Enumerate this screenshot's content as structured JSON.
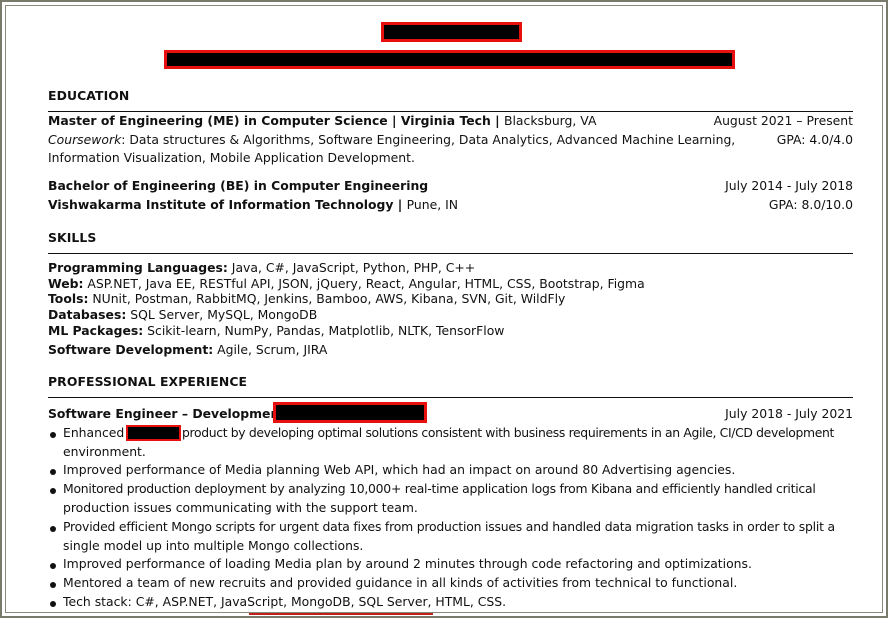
{
  "header": {
    "name_redacted": true,
    "contact_redacted": true
  },
  "education": {
    "title": "EDUCATION",
    "entries": [
      {
        "degree": "Master of Engineering (ME) in Computer Science",
        "sep": " | ",
        "school": "Virginia Tech",
        "sep2": " | ",
        "location": "Blacksburg, VA",
        "dates": "August 2021 – Present",
        "coursework_label": "Coursework",
        "coursework_line1": ": Data structures & Algorithms, Software Engineering, Data Analytics, Advanced Machine Learning,",
        "coursework_line2": "Information Visualization, Mobile Application Development.",
        "gpa": "GPA: 4.0/4.0"
      },
      {
        "degree": "Bachelor of Engineering (BE) in Computer Engineering",
        "dates": "July 2014 - July 2018",
        "school": "Vishwakarma Institute of Information Technology",
        "sep": " | ",
        "location": "Pune, IN",
        "gpa": "GPA: 8.0/10.0"
      }
    ]
  },
  "skills": {
    "title": "SKILLS",
    "items": [
      {
        "label": "Programming Languages:",
        "value": " Java, C#, JavaScript, Python, PHP, C++"
      },
      {
        "label": "Web:",
        "value": " ASP.NET, Java EE, RESTful API, JSON, jQuery, React, Angular, HTML, CSS, Bootstrap, Figma"
      },
      {
        "label": "Tools:",
        "value": " NUnit, Postman, RabbitMQ, Jenkins, Bamboo, AWS, Kibana, SVN, Git, WildFly"
      },
      {
        "label": "Databases:",
        "value": " SQL Server, MySQL,  MongoDB"
      },
      {
        "label": "ML Packages:",
        "value": " Scikit-learn, NumPy, Pandas, Matplotlib, NLTK, TensorFlow"
      },
      {
        "label": "Software Development:",
        "value": " Agile, Scrum, JIRA"
      }
    ]
  },
  "experience": {
    "title": "PROFESSIONAL EXPERIENCE",
    "jobs": [
      {
        "role": "Software Engineer – Development",
        "sep": " |",
        "company_redacted": true,
        "dates": "July 2018 - July 2021",
        "bullets": [
          {
            "pre": "Enhanced",
            "post": "product by developing optimal solutions consistent with business requirements in an Agile, CI/CD development",
            "cont": "environment."
          },
          {
            "text": "Improved performance of Media planning Web API, which had an impact on around 80 Advertising agencies."
          },
          {
            "text": "Monitored production deployment by analyzing 10,000+ real-time application logs from Kibana and efficiently handled critical",
            "cont": "production issues communicating with the support team."
          },
          {
            "text": "Provided efficient Mongo scripts for urgent data fixes from production issues and handled data migration tasks in order to split a",
            "cont": "single model up into multiple Mongo collections."
          },
          {
            "text": "Improved performance of loading Media plan by around 2 minutes through code refactoring and optimizations."
          },
          {
            "text": "Mentored a team of new recruits and provided guidance in all kinds of activities from technical to functional."
          },
          {
            "text": "Tech stack: C#, ASP.NET, JavaScript, MongoDB, SQL Server, HTML, CSS."
          }
        ]
      }
    ]
  }
}
